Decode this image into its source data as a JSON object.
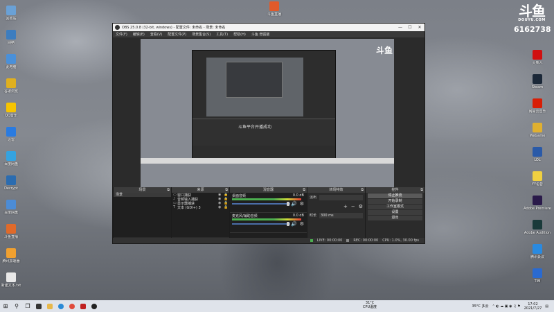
{
  "watermark": {
    "logo": "斗鱼",
    "site": "DOUYU.COM",
    "room": "6162738"
  },
  "desktop_icons_left": [
    {
      "label": "回收站",
      "color": "#6aa1d6"
    },
    {
      "label": "网络",
      "color": "#3d7dbf"
    },
    {
      "label": "此电脑",
      "color": "#4a90d9"
    },
    {
      "label": "谷歌浏览",
      "color": "#e0b020"
    },
    {
      "label": "QQ音乐",
      "color": "#f6c400"
    },
    {
      "label": "迅雷",
      "color": "#2a7be0"
    },
    {
      "label": "百度网盘",
      "color": "#35a3e0"
    },
    {
      "label": "Decrypt",
      "color": "#2b6cb0"
    },
    {
      "label": "百度网盘",
      "color": "#4c8cd6"
    },
    {
      "label": "斗鱼直播",
      "color": "#e06a2a"
    },
    {
      "label": "腾讯加速器",
      "color": "#f0a030"
    },
    {
      "label": "新建文本.txt",
      "color": "#e8e8e8"
    }
  ],
  "desktop_icons_right": [
    {
      "label": "火柴人",
      "color": "#d01010"
    },
    {
      "label": "Steam",
      "color": "#1b2838"
    },
    {
      "label": "网易云音乐",
      "color": "#d81e06"
    },
    {
      "label": "WeGame",
      "color": "#e0b030"
    },
    {
      "label": "LOL",
      "color": "#2a5aa8"
    },
    {
      "label": "YY语音",
      "color": "#f0d040"
    },
    {
      "label": "Adobe Premiere",
      "color": "#2a1a4a"
    },
    {
      "label": "Adobe Audition",
      "color": "#1a3a3a"
    },
    {
      "label": "腾讯会议",
      "color": "#2a8ae0"
    },
    {
      "label": "TIM",
      "color": "#2a6ad0"
    }
  ],
  "top_icon": {
    "label": "斗鱼直播",
    "color": "#e05a2a"
  },
  "obs": {
    "title": "OBS 25.0.8 (32-bit, windows) - 配置文件: 未命名 - 场景: 未命名",
    "menu": [
      "文件(F)",
      "编辑(E)",
      "查看(V)",
      "配置文件(P)",
      "场景集合(S)",
      "工具(T)",
      "帮助(H)",
      "斗鱼 增强版"
    ],
    "preview_msg": "斗鱼平台开播成功",
    "docks": {
      "scenes": {
        "title": "场景",
        "items": [
          "场景"
        ]
      },
      "sources": {
        "title": "来源",
        "items": [
          {
            "icon": "▭",
            "name": "窗口捕获"
          },
          {
            "icon": "♪",
            "name": "音频输入捕获"
          },
          {
            "icon": "▭",
            "name": "显示器捕获"
          },
          {
            "icon": "T",
            "name": "文本 (GDI+) 3"
          }
        ]
      },
      "mixer": {
        "title": "混音器",
        "channels": [
          {
            "name": "桌面音频",
            "db": "0.0 dB"
          },
          {
            "name": "麦克风/辅助音频",
            "db": "0.0 dB"
          }
        ]
      },
      "transitions": {
        "title": "转场特效",
        "fade": "淡出",
        "duration_label": "时长",
        "duration": "300 ms"
      },
      "controls": {
        "title": "控件",
        "buttons": [
          "停止推流",
          "开始录制",
          "工作室模式",
          "设置",
          "退出"
        ]
      }
    },
    "status": {
      "live": "LIVE: 00:00:00",
      "rec": "REC: 00:00:00",
      "cpu": "CPU: 1.0%, 30.00 fps"
    }
  },
  "taskbar": {
    "weather_temp": "31°C",
    "weather_label": "CPU温度",
    "tray_weather": "35°C 多云",
    "time": "17:02",
    "date": "2021/7/27"
  }
}
